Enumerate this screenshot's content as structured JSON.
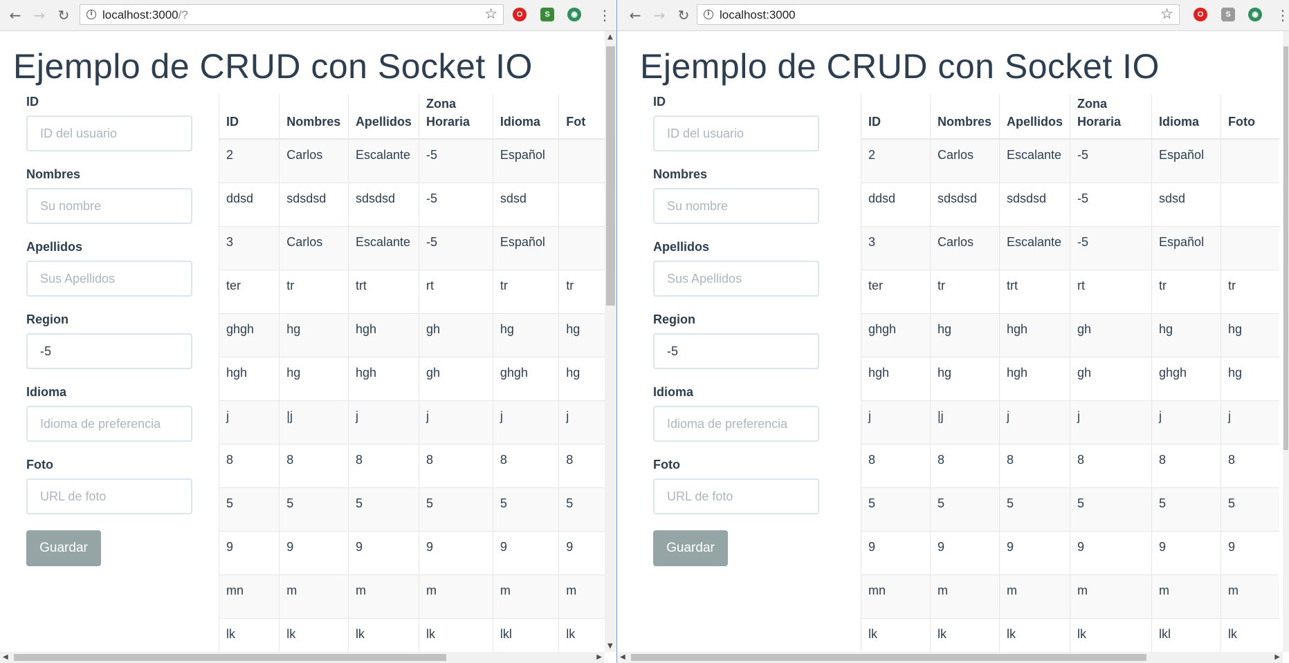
{
  "left": {
    "url_host": "localhost:3000",
    "url_path": "/?"
  },
  "right": {
    "url_host": "localhost:3000",
    "url_path": ""
  },
  "page": {
    "title": "Ejemplo de CRUD con Socket IO",
    "form": {
      "id_label": "ID",
      "id_placeholder": "ID del usuario",
      "nombres_label": "Nombres",
      "nombres_placeholder": "Su nombre",
      "apellidos_label": "Apellidos",
      "apellidos_placeholder": "Sus Apellidos",
      "region_label": "Region",
      "region_value": "-5",
      "idioma_label": "Idioma",
      "idioma_placeholder": "Idioma de preferencia",
      "foto_label": "Foto",
      "foto_placeholder": "URL de foto",
      "save_label": "Guardar"
    },
    "table": {
      "headers": [
        "ID",
        "Nombres",
        "Apellidos",
        "Zona Horaria",
        "Idioma",
        "Foto"
      ],
      "headers_left_truncated": [
        "ID",
        "Nombres",
        "Apellidos",
        "Zona Horaria",
        "Idioma",
        "Fot"
      ],
      "rows": [
        [
          "2",
          "Carlos",
          "Escalante",
          "-5",
          "Español",
          ""
        ],
        [
          "ddsd",
          "sdsdsd",
          "sdsdsd",
          "-5",
          "sdsd",
          ""
        ],
        [
          "3",
          "Carlos",
          "Escalante",
          "-5",
          "Español",
          ""
        ],
        [
          "ter",
          "tr",
          "trt",
          "rt",
          "tr",
          "tr"
        ],
        [
          "ghgh",
          "hg",
          "hgh",
          "gh",
          "hg",
          "hg"
        ],
        [
          "hgh",
          "hg",
          "hgh",
          "gh",
          "ghgh",
          "hg"
        ],
        [
          "j",
          "|j",
          "j",
          "j",
          "j",
          "j"
        ],
        [
          "8",
          "8",
          "8",
          "8",
          "8",
          "8"
        ],
        [
          "5",
          "5",
          "5",
          "5",
          "5",
          "5"
        ],
        [
          "9",
          "9",
          "9",
          "9",
          "9",
          "9"
        ],
        [
          "mn",
          "m",
          "m",
          "m",
          "m",
          "m"
        ],
        [
          "lk",
          "lk",
          "lk",
          "lk",
          "lkl",
          "lk"
        ]
      ]
    }
  },
  "icons": {
    "back": "←",
    "forward": "→",
    "reload": "↻",
    "info": "i",
    "star": "☆",
    "menu": "⋮",
    "opera": "O",
    "s_ext": "S",
    "globe": "◉",
    "up": "▲",
    "down": "▼",
    "lefta": "◀",
    "righta": "▶"
  }
}
